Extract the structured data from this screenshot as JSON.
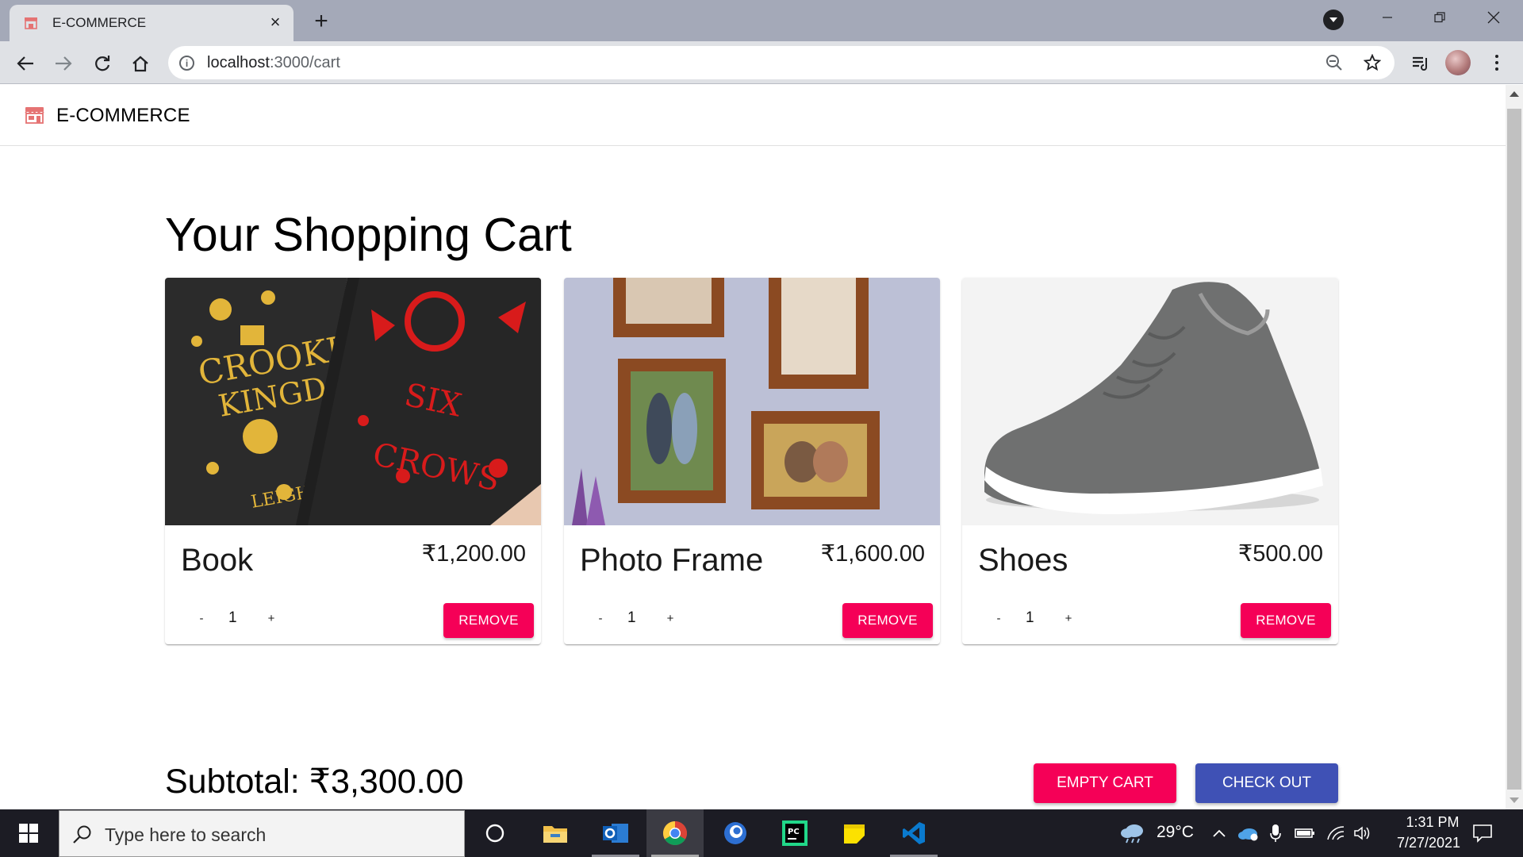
{
  "browser": {
    "tab_title": "E-COMMERCE",
    "url_host": "localhost",
    "url_path": ":3000/cart"
  },
  "app": {
    "brand": "E-COMMERCE"
  },
  "cart": {
    "heading": "Your Shopping Cart",
    "items": [
      {
        "name": "Book",
        "price": "₹1,200.00",
        "qty": "1",
        "minus": "-",
        "plus": "+",
        "remove_label": "REMOVE"
      },
      {
        "name": "Photo Frame",
        "price": "₹1,600.00",
        "qty": "1",
        "minus": "-",
        "plus": "+",
        "remove_label": "REMOVE"
      },
      {
        "name": "Shoes",
        "price": "₹500.00",
        "qty": "1",
        "minus": "-",
        "plus": "+",
        "remove_label": "REMOVE"
      }
    ],
    "subtotal": "Subtotal: ₹3,300.00",
    "empty_label": "EMPTY CART",
    "checkout_label": "CHECK OUT"
  },
  "colors": {
    "remove": "#f50057",
    "checkout": "#3f51b5"
  },
  "taskbar": {
    "search_placeholder": "Type here to search",
    "weather_temp": "29°C",
    "time": "1:31 PM",
    "date": "7/27/2021"
  }
}
